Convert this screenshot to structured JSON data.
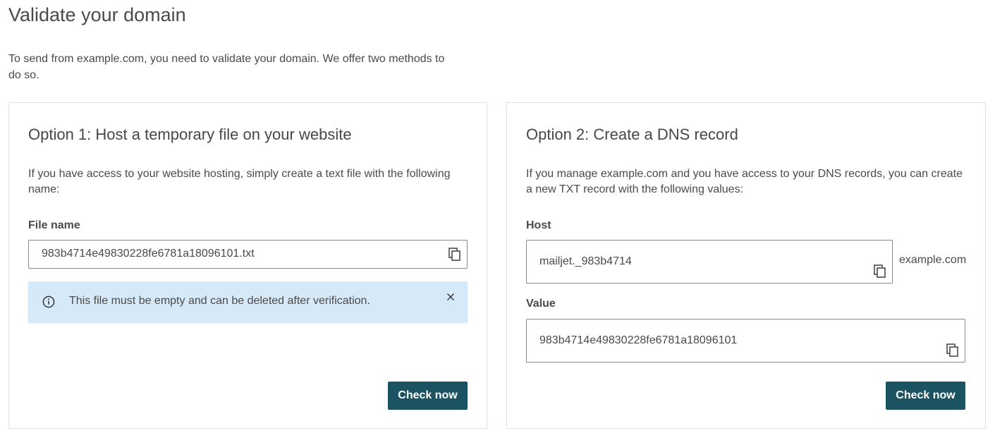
{
  "page": {
    "title": "Validate your domain",
    "intro": "To send from example.com, you need to validate your domain. We offer two methods to do so."
  },
  "option1": {
    "title": "Option 1: Host a temporary file on your website",
    "description": "If you have access to your website hosting, simply create a text file with the following name:",
    "file_name_label": "File name",
    "file_name_value": "983b4714e49830228fe6781a18096101.txt",
    "alert_message": "This file must be empty and can be deleted after verification.",
    "check_button": "Check now"
  },
  "option2": {
    "title": "Option 2: Create a DNS record",
    "description": "If you manage example.com and you have access to your DNS records, you can create a new TXT record with the following values:",
    "host_label": "Host",
    "host_value": "mailjet._983b4714",
    "host_suffix": "example.com",
    "value_label": "Value",
    "value_value": "983b4714e49830228fe6781a18096101",
    "check_button": "Check now"
  },
  "colors": {
    "button": "#1b5363",
    "alert_bg": "#d6e9f8",
    "border": "#e2e2e2"
  },
  "icons": [
    "copy-icon",
    "info-icon",
    "close-icon"
  ]
}
